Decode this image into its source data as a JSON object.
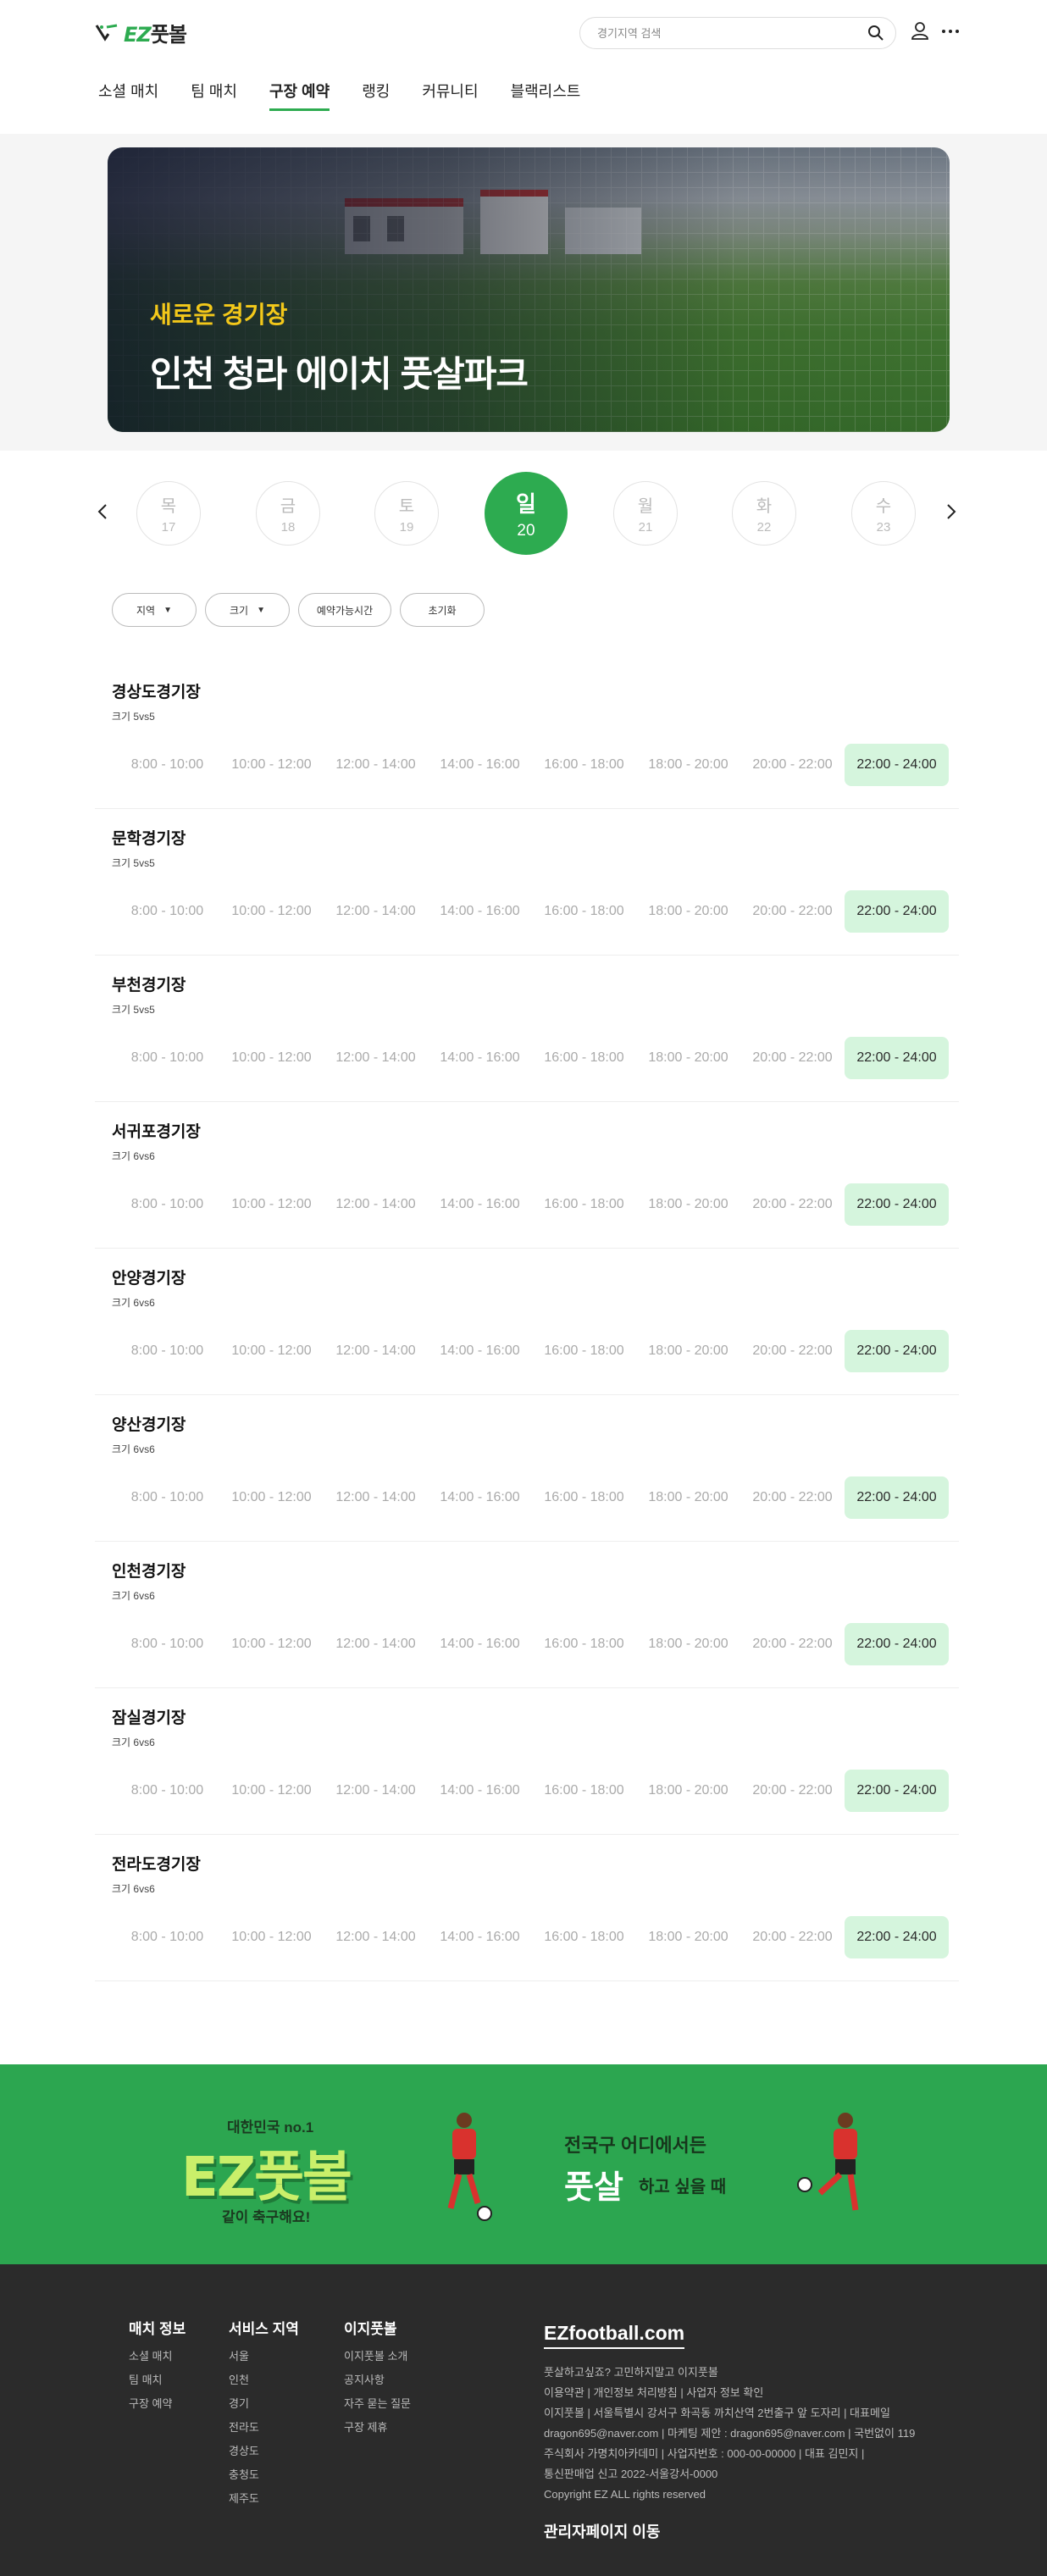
{
  "header": {
    "logo": {
      "prefix": "EZ",
      "suffix": "풋볼"
    },
    "search_placeholder": "경기지역 검색",
    "nav": [
      {
        "label": "소셜 매치",
        "active": false
      },
      {
        "label": "팀 매치",
        "active": false
      },
      {
        "label": "구장 예약",
        "active": true
      },
      {
        "label": "랭킹",
        "active": false
      },
      {
        "label": "커뮤니티",
        "active": false
      },
      {
        "label": "블랙리스트",
        "active": false
      }
    ]
  },
  "hero": {
    "subtitle": "새로운 경기장",
    "title": "인천 청라 에이치 풋살파크"
  },
  "dates": [
    {
      "day": "목",
      "date": "17",
      "active": false
    },
    {
      "day": "금",
      "date": "18",
      "active": false
    },
    {
      "day": "토",
      "date": "19",
      "active": false
    },
    {
      "day": "일",
      "date": "20",
      "active": true
    },
    {
      "day": "월",
      "date": "21",
      "active": false
    },
    {
      "day": "화",
      "date": "22",
      "active": false
    },
    {
      "day": "수",
      "date": "23",
      "active": false
    }
  ],
  "filters": {
    "region": "지역",
    "size": "크기",
    "available": "예약가능시간",
    "reset": "초기화"
  },
  "time_slots": [
    "8:00 - 10:00",
    "10:00 - 12:00",
    "12:00 - 14:00",
    "14:00 - 16:00",
    "16:00 - 18:00",
    "18:00 - 20:00",
    "20:00 - 22:00",
    "22:00 - 24:00"
  ],
  "stadiums": [
    {
      "name": "경상도경기장",
      "size": "크기 5vs5"
    },
    {
      "name": "문학경기장",
      "size": "크기 5vs5"
    },
    {
      "name": "부천경기장",
      "size": "크기 5vs5"
    },
    {
      "name": "서귀포경기장",
      "size": "크기 6vs6"
    },
    {
      "name": "안양경기장",
      "size": "크기 6vs6"
    },
    {
      "name": "양산경기장",
      "size": "크기 6vs6"
    },
    {
      "name": "인천경기장",
      "size": "크기 6vs6"
    },
    {
      "name": "잠실경기장",
      "size": "크기 6vs6"
    },
    {
      "name": "전라도경기장",
      "size": "크기 6vs6"
    }
  ],
  "open_slot_index": 7,
  "banner": {
    "top": "대한민국 no.1",
    "logo": "EZ풋볼",
    "bottom": "같이 축구해요!",
    "right_line1": "전국구 어디에서든",
    "right_big": "풋살",
    "right_small": "하고 싶을 때"
  },
  "footer": {
    "col1": {
      "title": "매치 정보",
      "links": [
        "소셜 매치",
        "팀 매치",
        "구장 예약"
      ]
    },
    "col2": {
      "title": "서비스 지역",
      "links": [
        "서울",
        "인천",
        "경기",
        "전라도",
        "경상도",
        "충청도",
        "제주도"
      ]
    },
    "col3": {
      "title": "이지풋볼",
      "links": [
        "이지풋볼 소개",
        "공지사항",
        "자주 묻는 질문",
        "구장 제휴"
      ]
    },
    "brand": "EZfootball.com",
    "info": [
      "풋살하고싶죠? 고민하지말고 이지풋볼",
      "이용약관 | 개인정보 처리방침 | 사업자 정보 확인",
      "이지풋볼 | 서울특별시 강서구 화곡동 까치산역 2번출구 앞 도자리 | 대표메일",
      "dragon695@naver.com | 마케팅 제안 : dragon695@naver.com | 국번없이 119",
      "주식회사 가명치아카데미 | 사업자번호 : 000-00-00000 | 대표 김민지 |",
      "통신판매업 신고 2022-서울강서-0000",
      "Copyright EZ ALL rights reserved"
    ],
    "admin": "관리자페이지 이동"
  },
  "colors": {
    "brand_green": "#2dab50",
    "slot_open": "#d5f5dd",
    "footer_bg": "#2b2b2b",
    "hero_accent": "#f3c81a"
  }
}
